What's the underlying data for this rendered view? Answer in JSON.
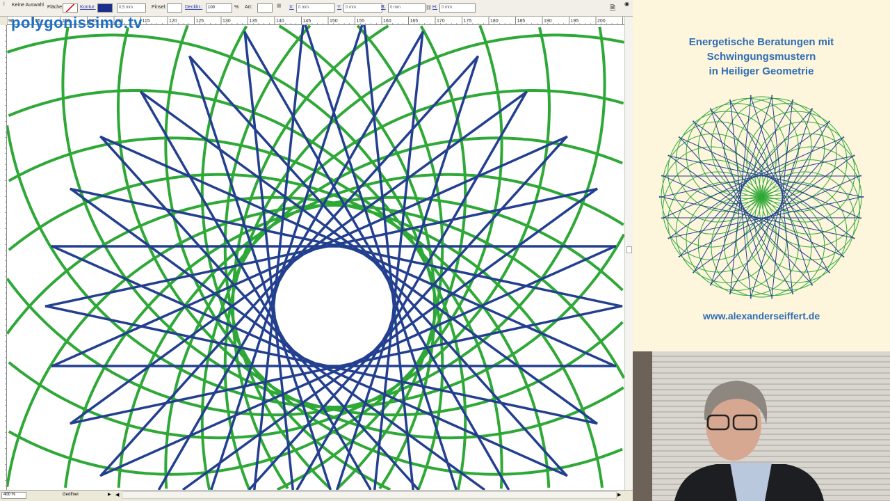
{
  "toolbar": {
    "selection": "Keine Auswahl",
    "fill_label": "Fläche:",
    "stroke_label": "Kontur:",
    "stroke_width": "0,5 mm",
    "brush_label": "Pinsel:",
    "opacity_label": "Deckkr.:",
    "opacity_value": "100",
    "opacity_unit": "%",
    "style_label": "Art:",
    "x_label": "X:",
    "x_value": "0 mm",
    "y_label": "Y:",
    "y_value": "0 mm",
    "w_label": "B:",
    "w_value": "0 mm",
    "h_label": "H:",
    "h_value": "0 mm"
  },
  "ruler": {
    "h_labels": [
      "90",
      "95",
      "100",
      "105",
      "110",
      "115",
      "120",
      "125",
      "130",
      "135",
      "140",
      "145",
      "150",
      "155",
      "160",
      "165",
      "170",
      "175",
      "180",
      "185",
      "190",
      "195",
      "200",
      "20"
    ]
  },
  "status": {
    "zoom": "400 %",
    "state": "Geöffnet"
  },
  "watermark": "polygonissimo.tv",
  "panel": {
    "title_lines": [
      "Energetische Beratungen mit",
      "Schwingungsmustern",
      "in Heiliger Geometrie"
    ],
    "url": "www.alexanderseiffert.de"
  },
  "colors": {
    "green": "#2ea836",
    "blue": "#233f8f",
    "panel_bg": "#fdf5dc",
    "title": "#2f6db5"
  }
}
